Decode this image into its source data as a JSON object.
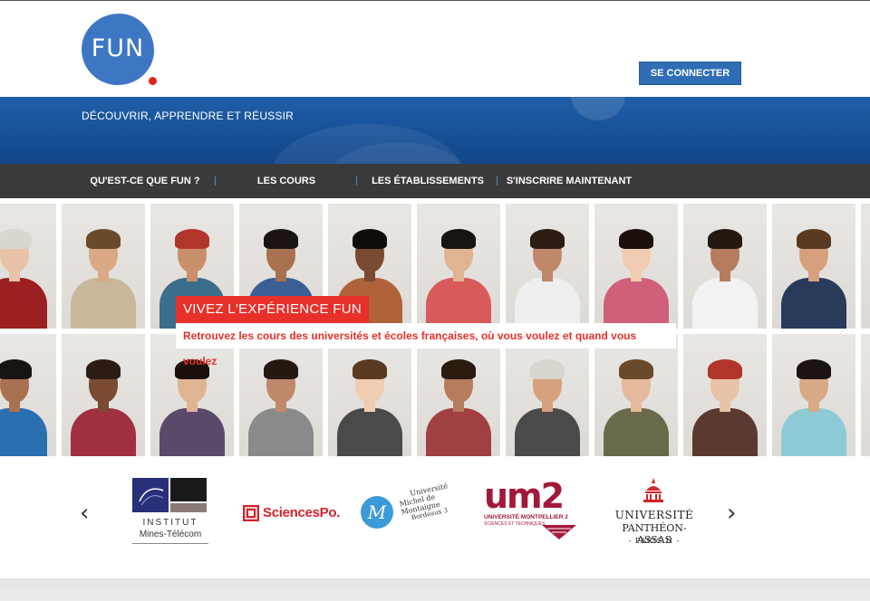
{
  "header": {
    "logo_text": "FUN",
    "login_label": "SE CONNECTER"
  },
  "banner": {
    "tagline": "DÉCOUVRIR, APPRENDRE ET RÉUSSIR"
  },
  "nav": {
    "items": [
      {
        "label": "QU'EST-CE QUE FUN ?"
      },
      {
        "label": "LES COURS"
      },
      {
        "label": "LES ÉTABLISSEMENTS"
      },
      {
        "label": "S'INSCRIRE MAINTENANT"
      }
    ]
  },
  "hero": {
    "title": "VIVEZ L'EXPÉRIENCE FUN",
    "subtitle": "Retrouvez les cours des universités et écoles françaises, où vous voulez et quand vous voulez"
  },
  "partners": {
    "logos": [
      {
        "name": "institut-mines-telecom",
        "line1": "INSTITUT",
        "line2": "Mines-Télécom"
      },
      {
        "name": "sciences-po",
        "text": "SciencesPo."
      },
      {
        "name": "universite-michel-de-montaigne",
        "line1": "Université",
        "line2": "Michel de Montaigne",
        "line3": "Bordeaux 3"
      },
      {
        "name": "universite-montpellier-2",
        "mark": "um2",
        "line1": "UNIVERSITÉ MONTPELLIER 2",
        "line2": "SCIENCES ET TECHNIQUES"
      },
      {
        "name": "universite-pantheon-assas",
        "line1": "UNIVERSITÉ",
        "line2": "PANTHÉON-ASSAS",
        "line3": "- PARIS II -"
      }
    ],
    "prev_icon": "chevron-left-icon",
    "next_icon": "chevron-right-icon"
  },
  "colors": {
    "brand_blue": "#3d77c4",
    "banner_blue": "#1a559c",
    "nav_bg": "#3a3a3a",
    "accent_red": "#e8302a"
  }
}
